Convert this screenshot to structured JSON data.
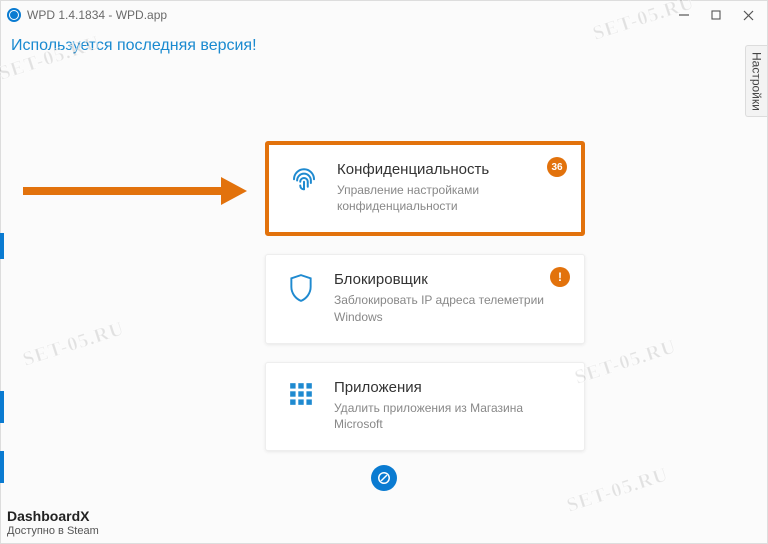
{
  "window": {
    "title": "WPD 1.4.1834 - WPD.app"
  },
  "status": "Используется последняя версия!",
  "settings_tab": "Настройки",
  "cards": {
    "privacy": {
      "title": "Конфиденциальность",
      "desc": "Управление настройками конфиденциальности",
      "badge": "36"
    },
    "blocker": {
      "title": "Блокировщик",
      "desc": "Заблокировать IP адреса телеметрии Windows",
      "badge": "!"
    },
    "apps": {
      "title": "Приложения",
      "desc": "Удалить приложения из Магазина Microsoft"
    }
  },
  "footer": {
    "brand": "DashboardX",
    "sub": "Доступно в Steam"
  },
  "watermark": "SET-05.RU"
}
